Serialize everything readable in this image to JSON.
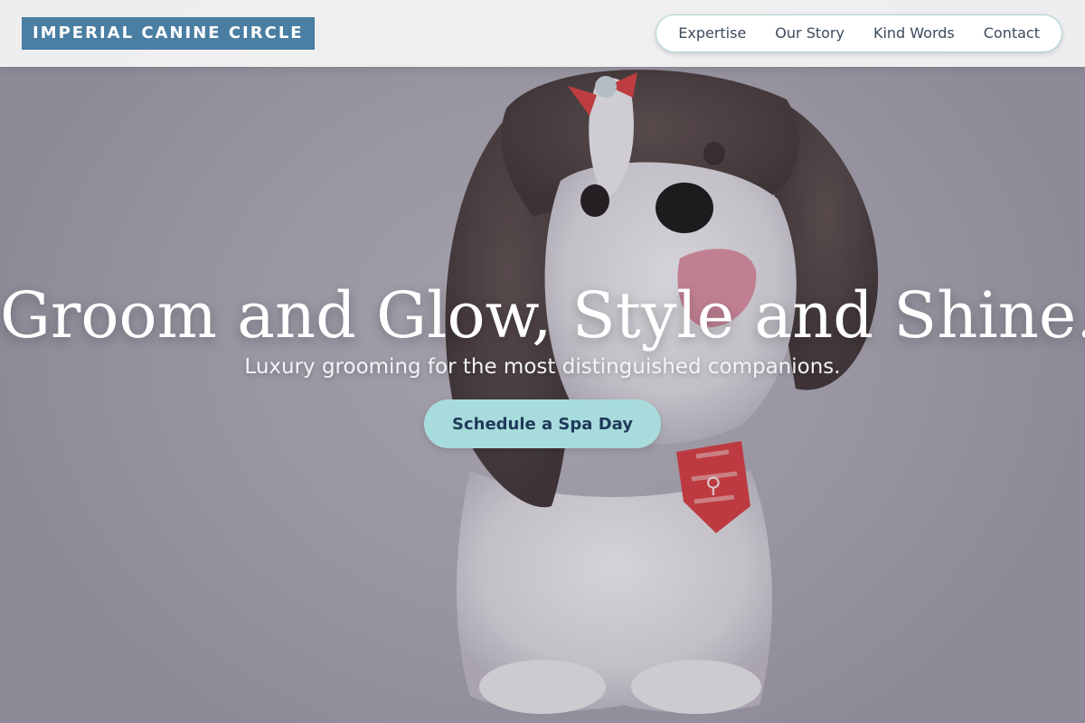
{
  "header": {
    "logo_text": "IMPERIAL CANINE CIRCLE",
    "nav": [
      {
        "label": "Expertise"
      },
      {
        "label": "Our Story"
      },
      {
        "label": "Kind Words"
      },
      {
        "label": "Contact"
      }
    ]
  },
  "hero": {
    "title": "Groom and Glow, Style and Shine.",
    "subtitle": "Luxury grooming for the most distinguished companions.",
    "cta_label": "Schedule a Spa Day",
    "image_icon": "dog-photo"
  },
  "colors": {
    "logo_bg": "#4a7ea3",
    "cta_bg": "#a8dcdc",
    "cta_text": "#1f3a5a",
    "nav_text": "#3b4a5c",
    "nav_border": "#a9d4d5"
  }
}
